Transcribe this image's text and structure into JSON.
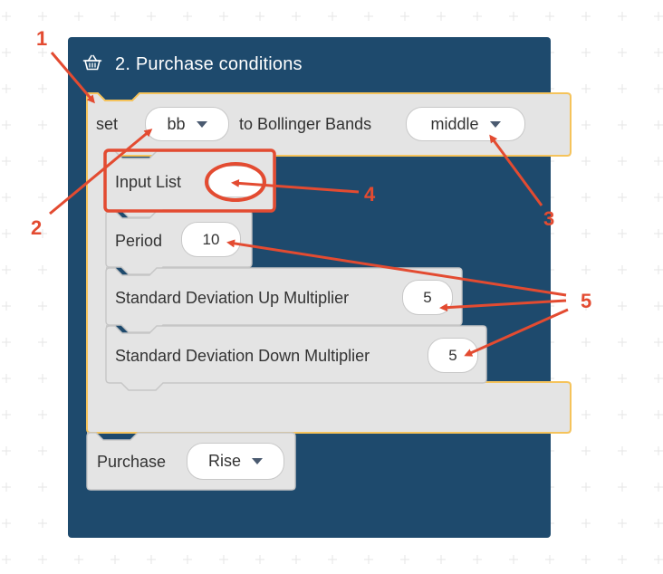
{
  "block": {
    "title": "2. Purchase conditions",
    "icon": "basket-icon",
    "header_color": "#1e4a6d",
    "accent": "#f5c35b"
  },
  "set_block": {
    "set_label": "set",
    "variable": "bb",
    "to_label": "to Bollinger Bands",
    "band": "middle"
  },
  "input_list": {
    "label": "Input List"
  },
  "period": {
    "label": "Period",
    "value": "10"
  },
  "std_up": {
    "label": "Standard Deviation Up Multiplier",
    "value": "5"
  },
  "std_down": {
    "label": "Standard Deviation Down Multiplier",
    "value": "5"
  },
  "purchase": {
    "label": "Purchase",
    "value": "Rise"
  },
  "annotations": {
    "color": "#e34b31",
    "labels": [
      "1",
      "2",
      "3",
      "4",
      "5"
    ]
  }
}
